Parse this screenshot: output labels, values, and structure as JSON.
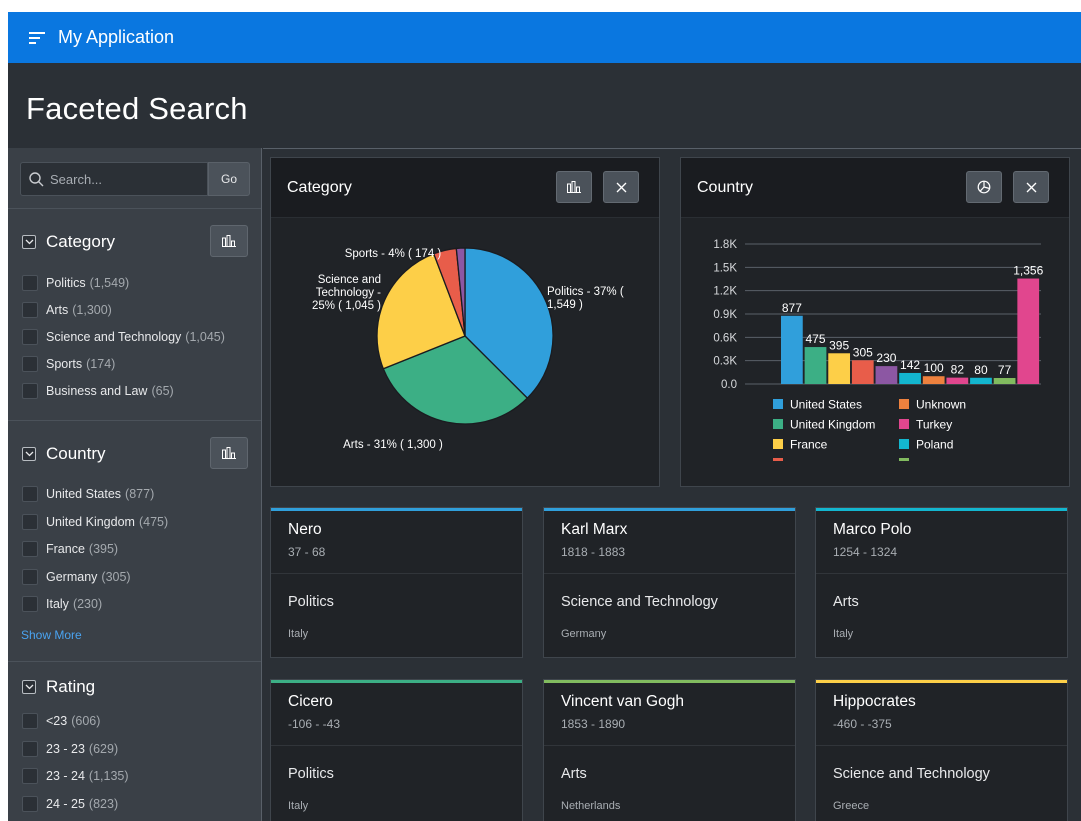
{
  "app": {
    "title": "My Application"
  },
  "page": {
    "title": "Faceted Search"
  },
  "search": {
    "placeholder": "Search...",
    "go_label": "Go"
  },
  "facets": {
    "category": {
      "title": "Category",
      "options": [
        {
          "label": "Politics",
          "count": "(1,549)"
        },
        {
          "label": "Arts",
          "count": "(1,300)"
        },
        {
          "label": "Science and Technology",
          "count": "(1,045)"
        },
        {
          "label": "Sports",
          "count": "(174)"
        },
        {
          "label": "Business and Law",
          "count": "(65)"
        }
      ]
    },
    "country": {
      "title": "Country",
      "options": [
        {
          "label": "United States",
          "count": "(877)"
        },
        {
          "label": "United Kingdom",
          "count": "(475)"
        },
        {
          "label": "France",
          "count": "(395)"
        },
        {
          "label": "Germany",
          "count": "(305)"
        },
        {
          "label": "Italy",
          "count": "(230)"
        }
      ],
      "show_more": "Show More"
    },
    "rating": {
      "title": "Rating",
      "options": [
        {
          "label": "<23",
          "count": "(606)"
        },
        {
          "label": "23 - 23",
          "count": "(629)"
        },
        {
          "label": "23 - 24",
          "count": "(1,135)"
        },
        {
          "label": "24 - 25",
          "count": "(823)"
        }
      ]
    }
  },
  "panels": {
    "category": {
      "title": "Category"
    },
    "country": {
      "title": "Country"
    }
  },
  "colors": {
    "header": "#0a77e0",
    "blue": "#309fdb",
    "green": "#3caf85",
    "yellow": "#fdcf48",
    "red": "#e85d4a",
    "purple": "#8c57a3",
    "orange": "#ed813e",
    "pink": "#e1468e",
    "teal": "#13b6cf",
    "lime": "#81bb5f"
  },
  "chart_data": [
    {
      "type": "pie",
      "title": "Category",
      "slices": [
        {
          "label": "Politics - 37% ( 1,549 )",
          "value": 1549,
          "color": "#309fdb"
        },
        {
          "label": "Arts - 31% ( 1,300 )",
          "value": 1300,
          "color": "#3caf85"
        },
        {
          "label": "Science and Technology - 25% ( 1,045 )",
          "value": 1045,
          "color": "#fdcf48"
        },
        {
          "label": "Sports - 4% ( 174 )",
          "value": 174,
          "color": "#e85d4a"
        },
        {
          "label": "",
          "value": 65,
          "color": "#8c57a3"
        }
      ],
      "label_lines": [
        [
          "Politics - 37% (",
          "1,549 )"
        ],
        [
          "Arts - 31% ( 1,300 )"
        ],
        [
          "Science and",
          "Technology -",
          "25% ( 1,045 )"
        ],
        [
          "Sports - 4% ( 174 )"
        ]
      ]
    },
    {
      "type": "bar",
      "title": "Country",
      "ylim": [
        0,
        1800
      ],
      "yticks": [
        "0.0",
        "0.3K",
        "0.6K",
        "0.9K",
        "1.2K",
        "1.5K",
        "1.8K"
      ],
      "ytick_values": [
        0,
        300,
        600,
        900,
        1200,
        1500,
        1800
      ],
      "bars": [
        {
          "value": 877,
          "label": "877",
          "color": "#309fdb"
        },
        {
          "value": 475,
          "label": "475",
          "color": "#3caf85"
        },
        {
          "value": 395,
          "label": "395",
          "color": "#fdcf48"
        },
        {
          "value": 305,
          "label": "305",
          "color": "#e85d4a"
        },
        {
          "value": 230,
          "label": "230",
          "color": "#8c57a3"
        },
        {
          "value": 142,
          "label": "142",
          "color": "#13b6cf"
        },
        {
          "value": 100,
          "label": "100",
          "color": "#ed813e"
        },
        {
          "value": 82,
          "label": "82",
          "color": "#e1468e"
        },
        {
          "value": 80,
          "label": "80",
          "color": "#13b6cf"
        },
        {
          "value": 77,
          "label": "77",
          "color": "#81bb5f"
        },
        {
          "value": 1356,
          "label": "1,356",
          "color": "#e1468e"
        }
      ],
      "legend": [
        {
          "name": "United States",
          "color": "#309fdb"
        },
        {
          "name": "Unknown",
          "color": "#ed813e"
        },
        {
          "name": "United Kingdom",
          "color": "#3caf85"
        },
        {
          "name": "Turkey",
          "color": "#e1468e"
        },
        {
          "name": "France",
          "color": "#fdcf48"
        },
        {
          "name": "Poland",
          "color": "#13b6cf"
        }
      ],
      "legend_placement": "bottom"
    }
  ],
  "cards": [
    {
      "name": "Nero",
      "years": "37 - 68",
      "category": "Politics",
      "country": "Italy",
      "color": "#309fdb"
    },
    {
      "name": "Karl Marx",
      "years": "1818 - 1883",
      "category": "Science and Technology",
      "country": "Germany",
      "color": "#309fdb"
    },
    {
      "name": "Marco Polo",
      "years": "1254 - 1324",
      "category": "Arts",
      "country": "Italy",
      "color": "#13b6cf"
    },
    {
      "name": "Cicero",
      "years": "-106 - -43",
      "category": "Politics",
      "country": "Italy",
      "color": "#3caf85"
    },
    {
      "name": "Vincent van Gogh",
      "years": "1853 - 1890",
      "category": "Arts",
      "country": "Netherlands",
      "color": "#81bb5f"
    },
    {
      "name": "Hippocrates",
      "years": "-460 - -375",
      "category": "Science and Technology",
      "country": "Greece",
      "color": "#fdcf48"
    }
  ]
}
